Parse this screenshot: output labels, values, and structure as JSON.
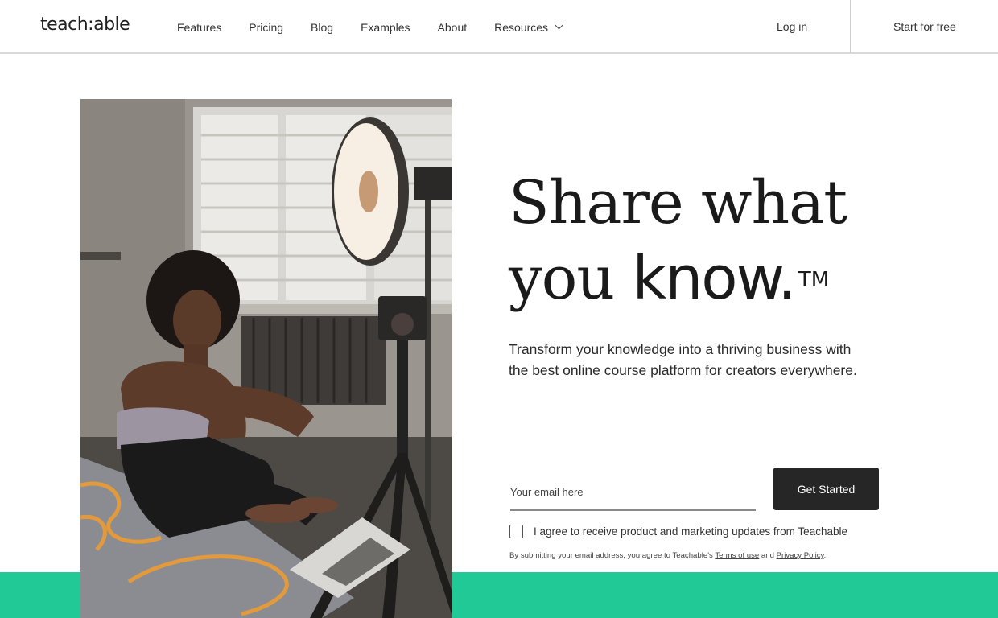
{
  "nav": {
    "logo": "teach:able",
    "links": [
      "Features",
      "Pricing",
      "Blog",
      "Examples",
      "About",
      "Resources"
    ],
    "login": "Log in",
    "start_free": "Start for free"
  },
  "hero": {
    "headline_line1": "Share what",
    "headline_you": "you ",
    "headline_know": "know.",
    "headline_tm": "TM",
    "subtitle": "Transform your knowledge into a thriving business with the best online course platform for creators everywhere."
  },
  "form": {
    "email_placeholder": "Your email here",
    "button": "Get Started",
    "consent": "I agree to receive product and marketing updates from Teachable",
    "legal_prefix": "By submitting your email address, you agree to Teachable's ",
    "terms": "Terms of use",
    "legal_and": " and ",
    "privacy": "Privacy Policy",
    "legal_suffix": "."
  },
  "colors": {
    "accent_green": "#21c997",
    "button_dark": "#262626"
  }
}
